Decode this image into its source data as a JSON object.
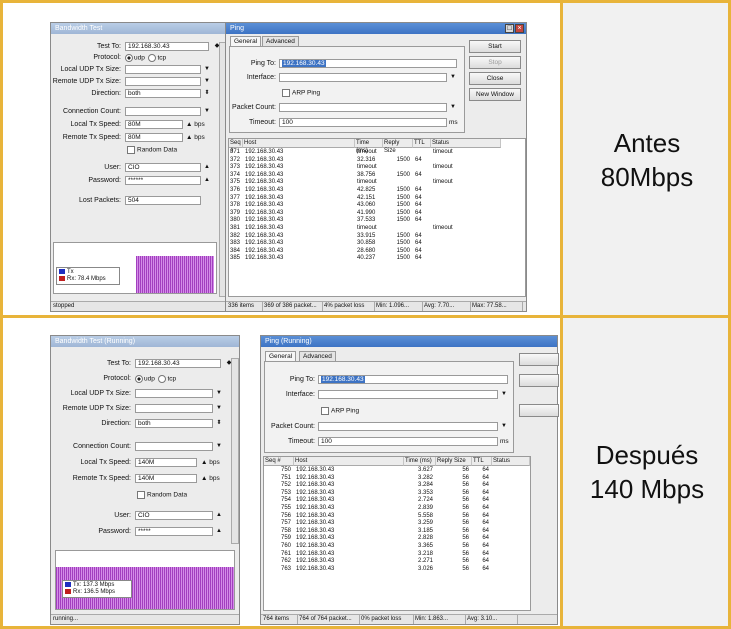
{
  "top": {
    "label_line1": "Antes",
    "label_line2": "80Mbps",
    "bw": {
      "title": "Bandwidth Test",
      "test_to_label": "Test To:",
      "test_to": "192.168.30.43",
      "protocol_label": "Protocol:",
      "udp": "udp",
      "tcp": "tcp",
      "local_udp_label": "Local UDP Tx Size:",
      "remote_udp_label": "Remote UDP Tx Size:",
      "direction_label": "Direction:",
      "direction": "both",
      "conn_count_label": "Connection Count:",
      "local_speed_label": "Local Tx Speed:",
      "local_speed": "80M",
      "remote_speed_label": "Remote Tx Speed:",
      "remote_speed": "80M",
      "unit": "bps",
      "random_data": "Random Data",
      "user_label": "User:",
      "user": "CIO",
      "password_label": "Password:",
      "password": "******",
      "lost_label": "Lost Packets:",
      "lost": "504",
      "tx_legend": "Tx",
      "rx_legend": "Rx: 78.4 Mbps",
      "status": "stopped",
      "graph_level": 0.75
    },
    "ping": {
      "title": "Ping",
      "tab_general": "General",
      "tab_advanced": "Advanced",
      "ping_to_label": "Ping To:",
      "ping_to": "192.168.30.43",
      "interface_label": "Interface:",
      "arp_ping": "ARP Ping",
      "packet_count_label": "Packet Count:",
      "timeout_label": "Timeout:",
      "timeout": "100",
      "ms": "ms",
      "btn_start": "Start",
      "btn_stop": "Stop",
      "btn_close": "Close",
      "btn_new": "New Window",
      "columns": [
        "Seq #",
        "Host",
        "Time (ms)",
        "Reply Size",
        "TTL",
        "Status"
      ],
      "rows": [
        [
          "371",
          "192.168.30.43",
          "timeout",
          "",
          "",
          "timeout"
        ],
        [
          "372",
          "192.168.30.43",
          "32.316",
          "1500",
          "64",
          ""
        ],
        [
          "373",
          "192.168.30.43",
          "timeout",
          "",
          "",
          "timeout"
        ],
        [
          "374",
          "192.168.30.43",
          "38.756",
          "1500",
          "64",
          ""
        ],
        [
          "375",
          "192.168.30.43",
          "timeout",
          "",
          "",
          "timeout"
        ],
        [
          "376",
          "192.168.30.43",
          "42.825",
          "1500",
          "64",
          ""
        ],
        [
          "377",
          "192.168.30.43",
          "42.151",
          "1500",
          "64",
          ""
        ],
        [
          "378",
          "192.168.30.43",
          "43.060",
          "1500",
          "64",
          ""
        ],
        [
          "379",
          "192.168.30.43",
          "41.990",
          "1500",
          "64",
          ""
        ],
        [
          "380",
          "192.168.30.43",
          "37.533",
          "1500",
          "64",
          ""
        ],
        [
          "381",
          "192.168.30.43",
          "timeout",
          "",
          "",
          "timeout"
        ],
        [
          "382",
          "192.168.30.43",
          "33.915",
          "1500",
          "64",
          ""
        ],
        [
          "383",
          "192.168.30.43",
          "30.858",
          "1500",
          "64",
          ""
        ],
        [
          "384",
          "192.168.30.43",
          "28.680",
          "1500",
          "64",
          ""
        ],
        [
          "385",
          "192.168.30.43",
          "40.237",
          "1500",
          "64",
          ""
        ]
      ],
      "status": [
        "336 items",
        "369 of 386 packet...",
        "4% packet loss",
        "Min: 1.096...",
        "Avg: 7.70...",
        "Max: 77.58..."
      ]
    }
  },
  "bottom": {
    "label_line1": "Después",
    "label_line2": "140 Mbps",
    "bw": {
      "title": "Bandwidth Test (Running)",
      "test_to_label": "Test To:",
      "test_to": "192.168.30.43",
      "protocol_label": "Protocol:",
      "udp": "udp",
      "tcp": "tcp",
      "local_udp_label": "Local UDP Tx Size:",
      "remote_udp_label": "Remote UDP Tx Size:",
      "direction_label": "Direction:",
      "direction": "both",
      "conn_count_label": "Connection Count:",
      "local_speed_label": "Local Tx Speed:",
      "local_speed": "140M",
      "remote_speed_label": "Remote Tx Speed:",
      "remote_speed": "140M",
      "unit": "bps",
      "random_data": "Random Data",
      "user_label": "User:",
      "user": "CIO",
      "password_label": "Password:",
      "password": "*****",
      "tx_legend": "Tx: 137.3 Mbps",
      "rx_legend": "Rx: 136.5 Mbps",
      "status": "running...",
      "graph_level": 0.72
    },
    "ping": {
      "title": "Ping (Running)",
      "tab_general": "General",
      "tab_advanced": "Advanced",
      "ping_to_label": "Ping To:",
      "ping_to": "192.168.30.43",
      "interface_label": "Interface:",
      "arp_ping": "ARP Ping",
      "packet_count_label": "Packet Count:",
      "timeout_label": "Timeout:",
      "timeout": "100",
      "ms": "ms",
      "columns": [
        "Seq #",
        "Host",
        "Time (ms)",
        "Reply Size",
        "TTL",
        "Status"
      ],
      "rows": [
        [
          "750",
          "192.168.30.43",
          "3.627",
          "56",
          "64",
          ""
        ],
        [
          "751",
          "192.168.30.43",
          "3.282",
          "56",
          "64",
          ""
        ],
        [
          "752",
          "192.168.30.43",
          "3.284",
          "56",
          "64",
          ""
        ],
        [
          "753",
          "192.168.30.43",
          "3.353",
          "56",
          "64",
          ""
        ],
        [
          "754",
          "192.168.30.43",
          "2.724",
          "56",
          "64",
          ""
        ],
        [
          "755",
          "192.168.30.43",
          "2.839",
          "56",
          "64",
          ""
        ],
        [
          "756",
          "192.168.30.43",
          "5.558",
          "56",
          "64",
          ""
        ],
        [
          "757",
          "192.168.30.43",
          "3.259",
          "56",
          "64",
          ""
        ],
        [
          "758",
          "192.168.30.43",
          "3.185",
          "56",
          "64",
          ""
        ],
        [
          "759",
          "192.168.30.43",
          "2.828",
          "56",
          "64",
          ""
        ],
        [
          "760",
          "192.168.30.43",
          "3.365",
          "56",
          "64",
          ""
        ],
        [
          "761",
          "192.168.30.43",
          "3.218",
          "56",
          "64",
          ""
        ],
        [
          "762",
          "192.168.30.43",
          "2.271",
          "56",
          "64",
          ""
        ],
        [
          "763",
          "192.168.30.43",
          "3.026",
          "56",
          "64",
          ""
        ]
      ],
      "status": [
        "764 items",
        "764 of 764 packet...",
        "0% packet loss",
        "Min: 1.863...",
        "Avg: 3.10..."
      ]
    }
  }
}
